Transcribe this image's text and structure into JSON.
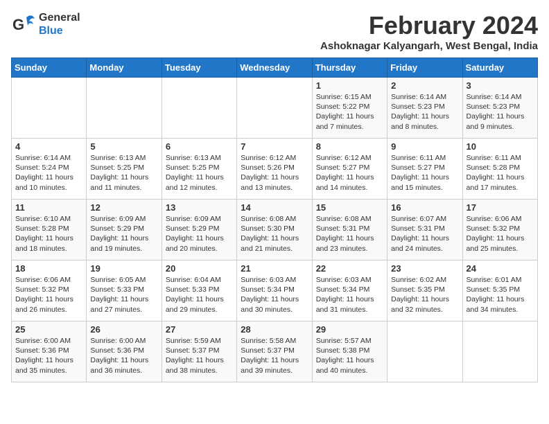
{
  "header": {
    "logo_line1": "General",
    "logo_line2": "Blue",
    "month_year": "February 2024",
    "location": "Ashoknagar Kalyangarh, West Bengal, India"
  },
  "weekdays": [
    "Sunday",
    "Monday",
    "Tuesday",
    "Wednesday",
    "Thursday",
    "Friday",
    "Saturday"
  ],
  "weeks": [
    [
      {
        "day": "",
        "sunrise": "",
        "sunset": "",
        "daylight": ""
      },
      {
        "day": "",
        "sunrise": "",
        "sunset": "",
        "daylight": ""
      },
      {
        "day": "",
        "sunrise": "",
        "sunset": "",
        "daylight": ""
      },
      {
        "day": "",
        "sunrise": "",
        "sunset": "",
        "daylight": ""
      },
      {
        "day": "1",
        "sunrise": "Sunrise: 6:15 AM",
        "sunset": "Sunset: 5:22 PM",
        "daylight": "Daylight: 11 hours and 7 minutes."
      },
      {
        "day": "2",
        "sunrise": "Sunrise: 6:14 AM",
        "sunset": "Sunset: 5:23 PM",
        "daylight": "Daylight: 11 hours and 8 minutes."
      },
      {
        "day": "3",
        "sunrise": "Sunrise: 6:14 AM",
        "sunset": "Sunset: 5:23 PM",
        "daylight": "Daylight: 11 hours and 9 minutes."
      }
    ],
    [
      {
        "day": "4",
        "sunrise": "Sunrise: 6:14 AM",
        "sunset": "Sunset: 5:24 PM",
        "daylight": "Daylight: 11 hours and 10 minutes."
      },
      {
        "day": "5",
        "sunrise": "Sunrise: 6:13 AM",
        "sunset": "Sunset: 5:25 PM",
        "daylight": "Daylight: 11 hours and 11 minutes."
      },
      {
        "day": "6",
        "sunrise": "Sunrise: 6:13 AM",
        "sunset": "Sunset: 5:25 PM",
        "daylight": "Daylight: 11 hours and 12 minutes."
      },
      {
        "day": "7",
        "sunrise": "Sunrise: 6:12 AM",
        "sunset": "Sunset: 5:26 PM",
        "daylight": "Daylight: 11 hours and 13 minutes."
      },
      {
        "day": "8",
        "sunrise": "Sunrise: 6:12 AM",
        "sunset": "Sunset: 5:27 PM",
        "daylight": "Daylight: 11 hours and 14 minutes."
      },
      {
        "day": "9",
        "sunrise": "Sunrise: 6:11 AM",
        "sunset": "Sunset: 5:27 PM",
        "daylight": "Daylight: 11 hours and 15 minutes."
      },
      {
        "day": "10",
        "sunrise": "Sunrise: 6:11 AM",
        "sunset": "Sunset: 5:28 PM",
        "daylight": "Daylight: 11 hours and 17 minutes."
      }
    ],
    [
      {
        "day": "11",
        "sunrise": "Sunrise: 6:10 AM",
        "sunset": "Sunset: 5:28 PM",
        "daylight": "Daylight: 11 hours and 18 minutes."
      },
      {
        "day": "12",
        "sunrise": "Sunrise: 6:09 AM",
        "sunset": "Sunset: 5:29 PM",
        "daylight": "Daylight: 11 hours and 19 minutes."
      },
      {
        "day": "13",
        "sunrise": "Sunrise: 6:09 AM",
        "sunset": "Sunset: 5:29 PM",
        "daylight": "Daylight: 11 hours and 20 minutes."
      },
      {
        "day": "14",
        "sunrise": "Sunrise: 6:08 AM",
        "sunset": "Sunset: 5:30 PM",
        "daylight": "Daylight: 11 hours and 21 minutes."
      },
      {
        "day": "15",
        "sunrise": "Sunrise: 6:08 AM",
        "sunset": "Sunset: 5:31 PM",
        "daylight": "Daylight: 11 hours and 23 minutes."
      },
      {
        "day": "16",
        "sunrise": "Sunrise: 6:07 AM",
        "sunset": "Sunset: 5:31 PM",
        "daylight": "Daylight: 11 hours and 24 minutes."
      },
      {
        "day": "17",
        "sunrise": "Sunrise: 6:06 AM",
        "sunset": "Sunset: 5:32 PM",
        "daylight": "Daylight: 11 hours and 25 minutes."
      }
    ],
    [
      {
        "day": "18",
        "sunrise": "Sunrise: 6:06 AM",
        "sunset": "Sunset: 5:32 PM",
        "daylight": "Daylight: 11 hours and 26 minutes."
      },
      {
        "day": "19",
        "sunrise": "Sunrise: 6:05 AM",
        "sunset": "Sunset: 5:33 PM",
        "daylight": "Daylight: 11 hours and 27 minutes."
      },
      {
        "day": "20",
        "sunrise": "Sunrise: 6:04 AM",
        "sunset": "Sunset: 5:33 PM",
        "daylight": "Daylight: 11 hours and 29 minutes."
      },
      {
        "day": "21",
        "sunrise": "Sunrise: 6:03 AM",
        "sunset": "Sunset: 5:34 PM",
        "daylight": "Daylight: 11 hours and 30 minutes."
      },
      {
        "day": "22",
        "sunrise": "Sunrise: 6:03 AM",
        "sunset": "Sunset: 5:34 PM",
        "daylight": "Daylight: 11 hours and 31 minutes."
      },
      {
        "day": "23",
        "sunrise": "Sunrise: 6:02 AM",
        "sunset": "Sunset: 5:35 PM",
        "daylight": "Daylight: 11 hours and 32 minutes."
      },
      {
        "day": "24",
        "sunrise": "Sunrise: 6:01 AM",
        "sunset": "Sunset: 5:35 PM",
        "daylight": "Daylight: 11 hours and 34 minutes."
      }
    ],
    [
      {
        "day": "25",
        "sunrise": "Sunrise: 6:00 AM",
        "sunset": "Sunset: 5:36 PM",
        "daylight": "Daylight: 11 hours and 35 minutes."
      },
      {
        "day": "26",
        "sunrise": "Sunrise: 6:00 AM",
        "sunset": "Sunset: 5:36 PM",
        "daylight": "Daylight: 11 hours and 36 minutes."
      },
      {
        "day": "27",
        "sunrise": "Sunrise: 5:59 AM",
        "sunset": "Sunset: 5:37 PM",
        "daylight": "Daylight: 11 hours and 38 minutes."
      },
      {
        "day": "28",
        "sunrise": "Sunrise: 5:58 AM",
        "sunset": "Sunset: 5:37 PM",
        "daylight": "Daylight: 11 hours and 39 minutes."
      },
      {
        "day": "29",
        "sunrise": "Sunrise: 5:57 AM",
        "sunset": "Sunset: 5:38 PM",
        "daylight": "Daylight: 11 hours and 40 minutes."
      },
      {
        "day": "",
        "sunrise": "",
        "sunset": "",
        "daylight": ""
      },
      {
        "day": "",
        "sunrise": "",
        "sunset": "",
        "daylight": ""
      }
    ]
  ]
}
